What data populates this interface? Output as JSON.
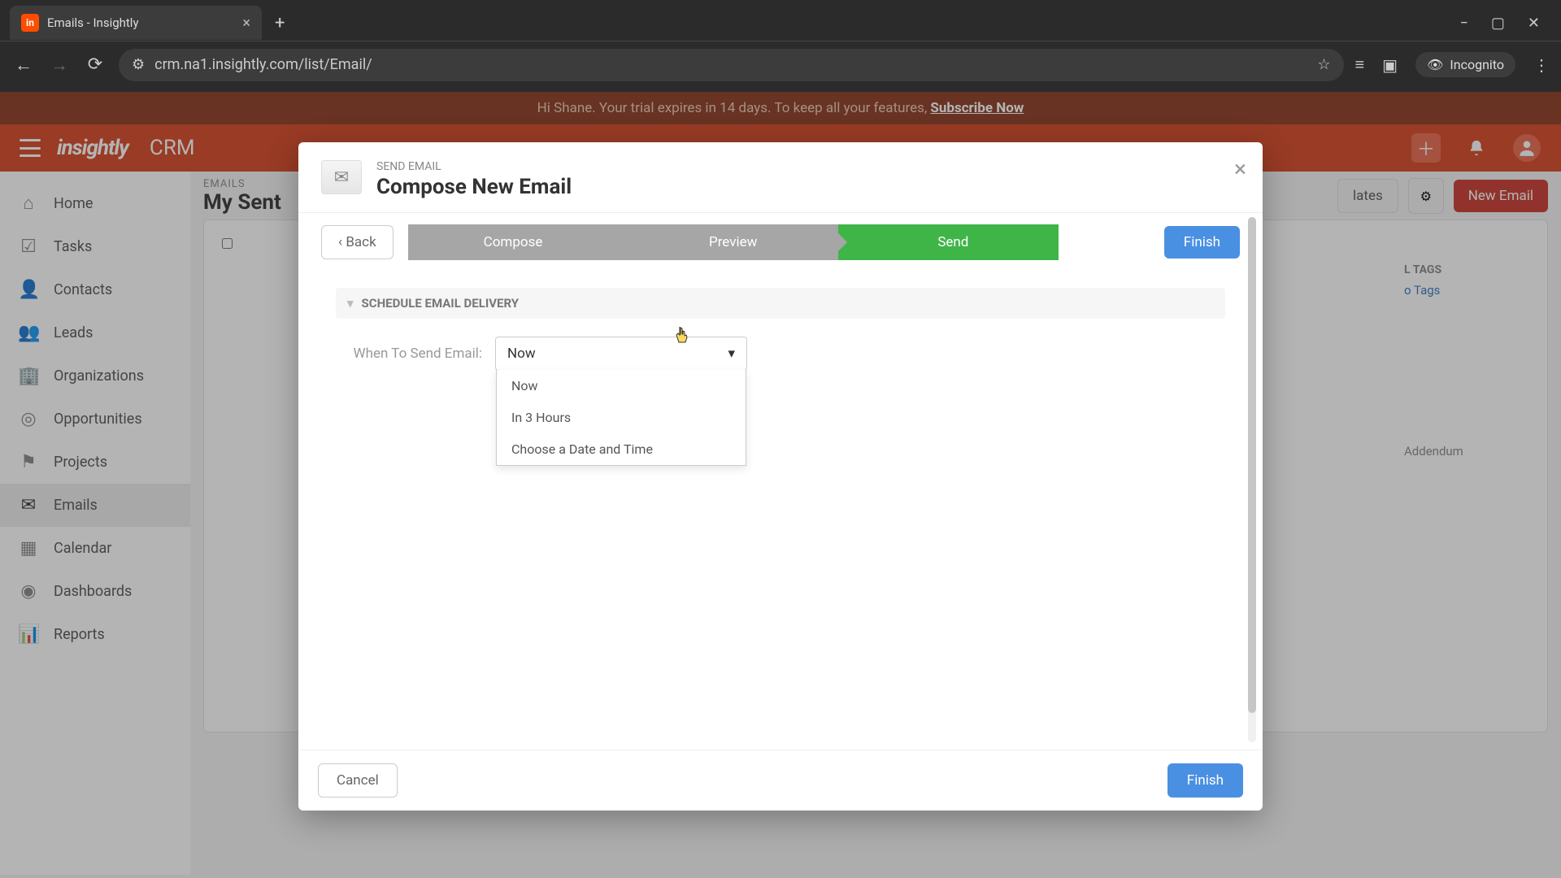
{
  "browser": {
    "tab_title": "Emails - Insightly",
    "url": "crm.na1.insightly.com/list/Email/",
    "incognito_label": "Incognito"
  },
  "trial": {
    "greeting": "Hi Shane. Your trial expires in 14 days. To keep all your features, ",
    "cta": "Subscribe Now"
  },
  "header": {
    "logo": "insightly",
    "product": "CRM"
  },
  "sidebar": {
    "items": [
      {
        "label": "Home"
      },
      {
        "label": "Tasks"
      },
      {
        "label": "Contacts"
      },
      {
        "label": "Leads"
      },
      {
        "label": "Organizations"
      },
      {
        "label": "Opportunities"
      },
      {
        "label": "Projects"
      },
      {
        "label": "Emails"
      },
      {
        "label": "Calendar"
      },
      {
        "label": "Dashboards"
      },
      {
        "label": "Reports"
      }
    ]
  },
  "main": {
    "eyebrow": "EMAILS",
    "title": "My Sent",
    "templates_btn": "lates",
    "new_email_btn": "New Email",
    "tags_title": "L TAGS",
    "no_tags": "o Tags",
    "addendum": "Addendum"
  },
  "modal": {
    "eyebrow": "SEND EMAIL",
    "title": "Compose New Email",
    "back": "Back",
    "steps": [
      "Compose",
      "Preview",
      "Send"
    ],
    "finish_top": "Finish",
    "section_title": "SCHEDULE EMAIL DELIVERY",
    "field_label": "When To Send Email:",
    "selected": "Now",
    "options": [
      "Now",
      "In 3 Hours",
      "Choose a Date and Time"
    ],
    "cancel": "Cancel",
    "finish_bottom": "Finish"
  }
}
